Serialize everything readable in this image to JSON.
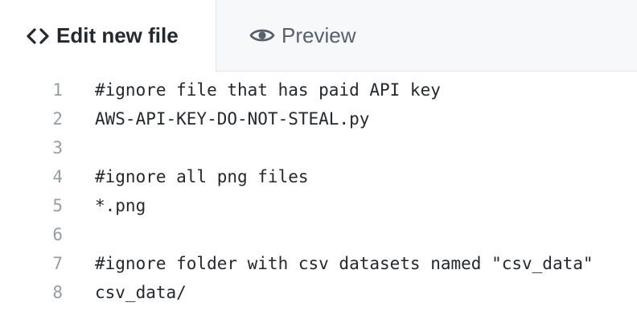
{
  "tabs": {
    "edit": {
      "label": "Edit new file",
      "icon": "code-icon"
    },
    "preview": {
      "label": "Preview",
      "icon": "eye-icon"
    }
  },
  "editor": {
    "lines": [
      {
        "number": "1",
        "text": "#ignore file that has paid API key"
      },
      {
        "number": "2",
        "text": "AWS-API-KEY-DO-NOT-STEAL.py"
      },
      {
        "number": "3",
        "text": ""
      },
      {
        "number": "4",
        "text": "#ignore all png files"
      },
      {
        "number": "5",
        "text": "*.png"
      },
      {
        "number": "6",
        "text": ""
      },
      {
        "number": "7",
        "text": "#ignore folder with csv datasets named \"csv_data\""
      },
      {
        "number": "8",
        "text": "csv_data/"
      }
    ]
  },
  "colors": {
    "text": "#24292e",
    "muted": "#586069",
    "line_number": "#959da5",
    "tab_bar_bg": "#f6f8fa",
    "border": "#e1e4e8"
  }
}
